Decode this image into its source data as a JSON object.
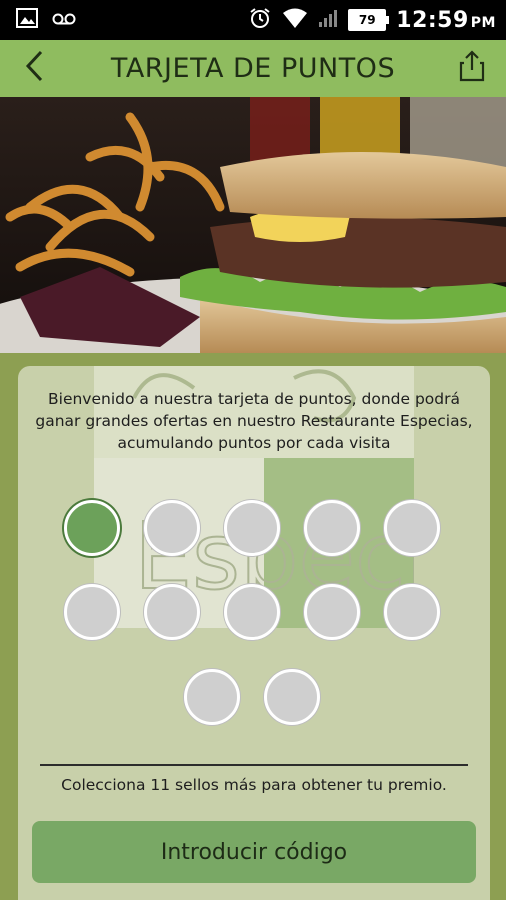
{
  "status_bar": {
    "time": "12:59",
    "ampm": "PM",
    "battery_level": "79",
    "icons": [
      "image-icon",
      "voicemail-icon",
      "alarm-icon",
      "wifi-icon",
      "signal-icon",
      "battery-icon"
    ]
  },
  "app_bar": {
    "title": "TARJETA DE PUNTOS",
    "back_icon": "chevron-left-icon",
    "share_icon": "share-icon"
  },
  "hero": {
    "image_description_icon": "burger-photo"
  },
  "card": {
    "intro_text": "Bienvenido a nuestra tarjeta de puntos, donde podrá ganar grandes ofertas en nuestro Restaurante Especias, acumulando puntos por cada visita",
    "watermark_brand": "Especias",
    "stamps_total": 12,
    "stamps_collected": 1,
    "collect_message": "Colecciona 11 sellos más para obtener tu premio.",
    "code_button_label": "Introducir código"
  },
  "colors": {
    "app_bar": "#8fbc5f",
    "background": "#8d9f52",
    "card": "#c8d0aa",
    "stamp_filled": "#6ca15a",
    "stamp_empty": "#cfcfcf",
    "button": "#79a865"
  }
}
